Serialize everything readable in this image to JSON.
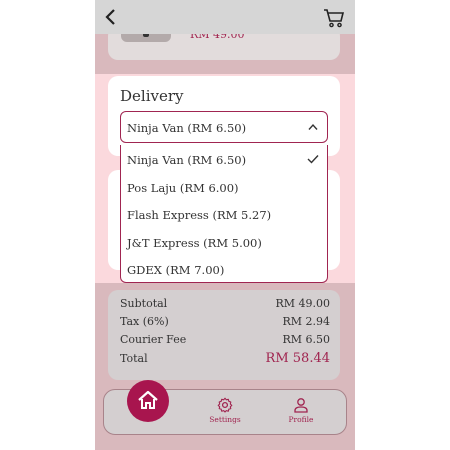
{
  "header": {
    "back_icon": "chevron-left-icon",
    "cart_icon": "cart-icon"
  },
  "product": {
    "price": "RM 49.00"
  },
  "delivery": {
    "title": "Delivery",
    "selected": "Ninja Van (RM 6.50)",
    "options": [
      {
        "label": "Ninja Van (RM 6.50)",
        "selected": true
      },
      {
        "label": "Pos Laju (RM 6.00)",
        "selected": false
      },
      {
        "label": "Flash Express (RM 5.27)",
        "selected": false
      },
      {
        "label": "J&T Express (RM 5.00)",
        "selected": false
      },
      {
        "label": "GDEX (RM 7.00)",
        "selected": false
      }
    ]
  },
  "summary": {
    "subtotal_label": "Subtotal",
    "subtotal": "RM 49.00",
    "tax_label": "Tax (6%)",
    "tax": "RM 2.94",
    "courier_label": "Courier Fee",
    "courier": "RM 6.50",
    "total_label": "Total",
    "total": "RM 58.44"
  },
  "nav": {
    "settings": "Settings",
    "profile": "Profile"
  },
  "colors": {
    "accent": "#a8154e",
    "background": "#fbd9dd",
    "dim": "#d9b9bd"
  }
}
